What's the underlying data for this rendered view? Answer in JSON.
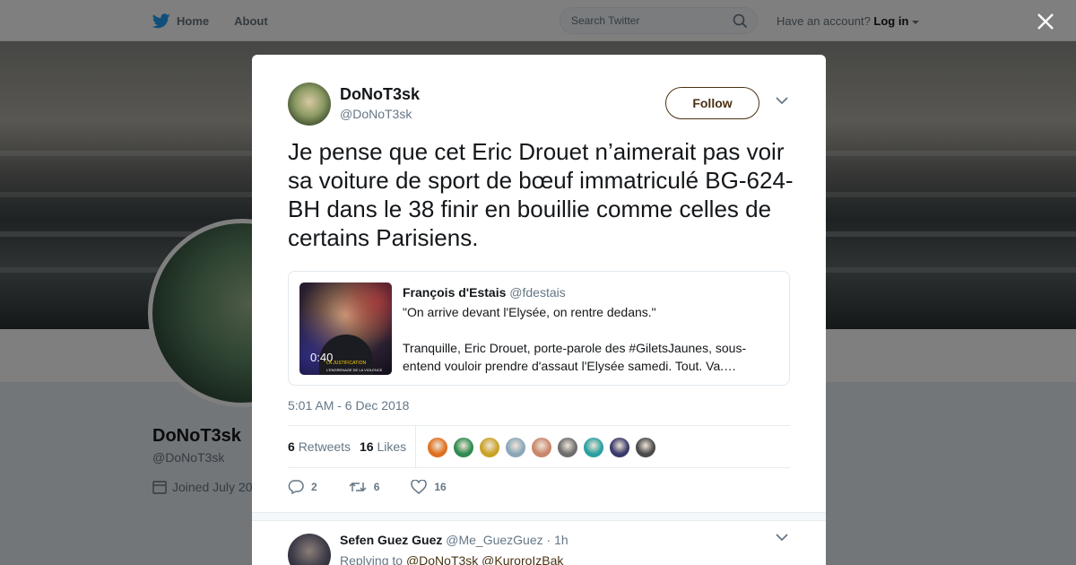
{
  "nav": {
    "home_label": "Home",
    "about_label": "About",
    "search_placeholder": "Search Twitter",
    "account_prefix": "Have an account?",
    "login_label": "Log in"
  },
  "background_profile": {
    "name": "DoNoT3sk",
    "handle": "@DoNoT3sk",
    "joined": "Joined July 20"
  },
  "tweet": {
    "author_name": "DoNoT3sk",
    "author_handle": "@DoNoT3sk",
    "follow_label": "Follow",
    "text": "Je pense que cet Eric Drouet n’aimerait pas voir sa voiture de sport de bœuf immatriculé BG-624-BH dans le 38 finir en bouillie comme celles de certains Parisiens.",
    "quote": {
      "name": "François d'Estais",
      "handle": "@fdestais",
      "line1": "\"On arrive devant l'Elysée, on rentre dedans.\"",
      "line2": "Tranquille, Eric Drouet, porte-parole des #GiletsJaunes, sous-entend vouloir prendre d'assaut l'Elysée samedi. Tout. Va.…",
      "video_duration": "0:40",
      "video_caption_1": "LA JUSTIFICATION",
      "video_caption_2": "L'ENGRENAGE DE LA VIOLENCE"
    },
    "timestamp": "5:01 AM - 6 Dec 2018",
    "retweets_count": "6",
    "retweets_label": "Retweets",
    "likes_count": "16",
    "likes_label": "Likes",
    "likers_colors": [
      "#e07020",
      "#2e8b4f",
      "#c9a227",
      "#8aa7b8",
      "#c8866a",
      "#6d6d6d",
      "#2aa0a0",
      "#3a3a6a",
      "#4a4a4a"
    ],
    "reply_count": "2",
    "retweet_action_count": "6",
    "like_action_count": "16"
  },
  "reply": {
    "name": "Sefen Guez Guez",
    "handle": "@Me_GuezGuez",
    "time": "1h",
    "replying_prefix": "Replying to",
    "mention_1": "@DoNoT3sk",
    "mention_2": "@KuroroIzBak"
  }
}
